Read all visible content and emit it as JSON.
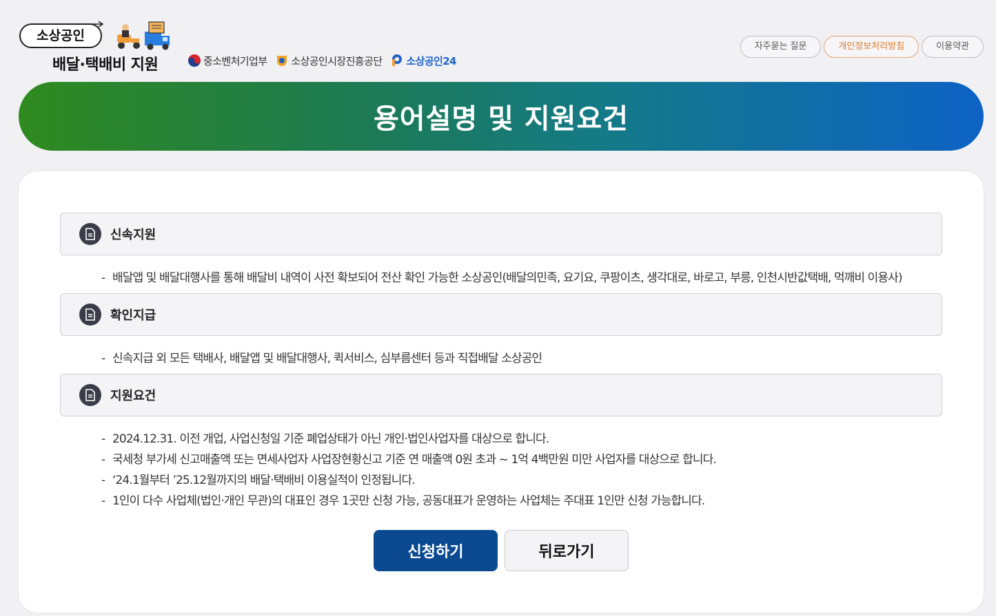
{
  "header": {
    "logo_pill": "소상공인",
    "logo_subtitle": "배달·택배비 지원",
    "orgs": [
      {
        "label": "중소벤처기업부",
        "icon": "korea-emblem-icon"
      },
      {
        "label": "소상공인시장진흥공단",
        "icon": "semas-emblem-icon"
      },
      {
        "label": "소상공인24",
        "icon": "sbiz24-logo-icon"
      }
    ],
    "links": [
      {
        "label": "자주묻는 질문"
      },
      {
        "label": "개인정보처리방침"
      },
      {
        "label": "이용약관"
      }
    ]
  },
  "banner": {
    "title": "용어설명 및 지원요건"
  },
  "sections": [
    {
      "title": "신속지원",
      "items": [
        "배달앱 및 배달대행사를 통해 배달비 내역이 사전 확보되어 전산 확인 가능한 소상공인(배달의민족, 요기요, 쿠팡이츠, 생각대로, 바로고, 부릉, 인천시반값택배, 먹깨비 이용사)"
      ]
    },
    {
      "title": "확인지급",
      "items": [
        "신속지급 외 모든 택배사, 배달앱 및 배달대행사, 퀵서비스, 심부름센터 등과 직접배달 소상공인"
      ]
    },
    {
      "title": "지원요건",
      "items": [
        "2024.12.31. 이전 개업, 사업신청일 기준 폐업상태가 아닌 개인·법인사업자를 대상으로 합니다.",
        "국세청 부가세 신고매출액 또는 면세사업자 사업장현황신고 기준 연 매출액 0원 초과 ~ 1억 4백만원 미만 사업자를 대상으로 합니다.",
        "‘24.1월부터 ’25.12월까지의 배달·택배비 이용실적이 인정됩니다.",
        "1인이 다수 사업체(법인·개인 무관)의 대표인 경우 1곳만 신청 가능, 공동대표가 운영하는 사업체는 주대표 1인만 신청 가능합니다."
      ]
    }
  ],
  "buttons": {
    "apply": "신청하기",
    "back": "뒤로가기"
  },
  "bullet_dash": "-",
  "colors": {
    "primary": "#0b4a90",
    "accent": "#e07a2a",
    "banner_start": "#2f8a1f",
    "banner_end": "#0d62c5"
  }
}
